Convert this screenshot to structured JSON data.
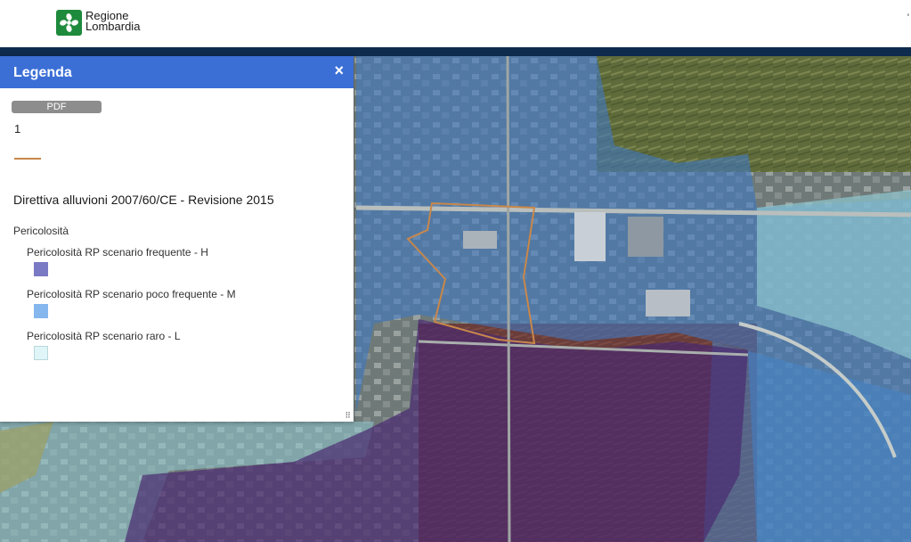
{
  "header": {
    "logo_line1": "Regione",
    "logo_line2": "Lombardia",
    "brand_color": "#1e8a3c",
    "bar_color": "#0e2a4d",
    "right_marker": "'"
  },
  "legend": {
    "title": "Legenda",
    "close_glyph": "×",
    "pdf_label": "PDF",
    "item_number": "1",
    "boundary_color": "#c8874a",
    "section_title": "Direttiva alluvioni 2007/60/CE - Revisione 2015",
    "group_title": "Pericolosità",
    "items": [
      {
        "label": "Pericolosità RP scenario frequente - H",
        "color": "#7a7ac4"
      },
      {
        "label": "Pericolosità RP scenario poco frequente - M",
        "color": "#86b6ee"
      },
      {
        "label": "Pericolosità RP scenario raro - L",
        "color": "#dff5f8"
      }
    ],
    "resize_glyph": "⠿"
  },
  "colors": {
    "header_accent": "#3b6fd6",
    "hazard_high": "#4a2a70",
    "hazard_medium": "#3f78c2",
    "hazard_low": "#8fc8cf"
  }
}
